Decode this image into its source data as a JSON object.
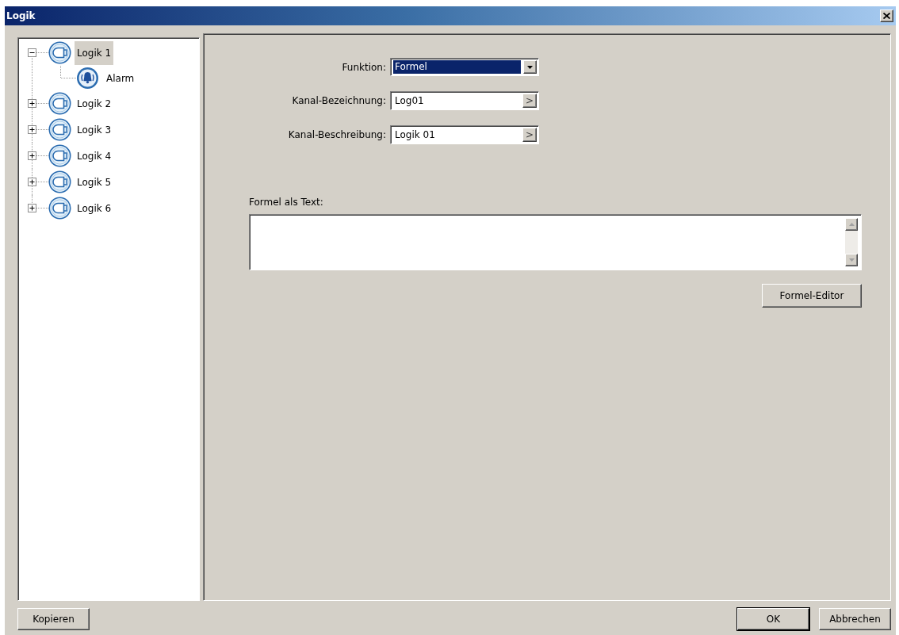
{
  "window": {
    "title": "Logik"
  },
  "tree": {
    "items": [
      {
        "label": "Logik 1",
        "kind": "logic",
        "expanded": true,
        "selected": true,
        "children": [
          {
            "label": "Alarm",
            "kind": "alarm",
            "selected": false
          }
        ]
      },
      {
        "label": "Logik 2",
        "kind": "logic",
        "expanded": false,
        "selected": false
      },
      {
        "label": "Logik 3",
        "kind": "logic",
        "expanded": false,
        "selected": false
      },
      {
        "label": "Logik 4",
        "kind": "logic",
        "expanded": false,
        "selected": false
      },
      {
        "label": "Logik 5",
        "kind": "logic",
        "expanded": false,
        "selected": false
      },
      {
        "label": "Logik 6",
        "kind": "logic",
        "expanded": false,
        "selected": false
      }
    ]
  },
  "form": {
    "fields": [
      {
        "kind": "dropdown",
        "label": "Funktion:",
        "value": "Formel",
        "highlighted": true
      },
      {
        "kind": "text",
        "label": "Kanal-Bezeichnung:",
        "value": "Log01",
        "button": ">"
      },
      {
        "kind": "text",
        "label": "Kanal-Beschreibung:",
        "value": "Logik 01",
        "button": ">"
      }
    ],
    "formula": {
      "label": "Formel als Text:",
      "button": "Formel-Editor"
    }
  },
  "footer": {
    "left_buttons": [
      {
        "label": "Kopieren",
        "default": false
      }
    ],
    "right_buttons": [
      {
        "label": "OK",
        "default": true
      },
      {
        "label": "Abbrechen",
        "default": false
      }
    ]
  }
}
